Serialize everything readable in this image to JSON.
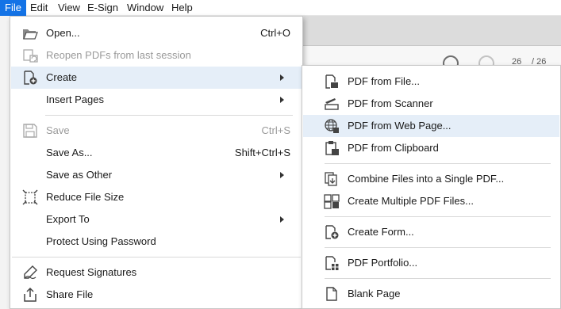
{
  "menubar": {
    "items": [
      "File",
      "Edit",
      "View",
      "E-Sign",
      "Window",
      "Help"
    ],
    "active": "File"
  },
  "background": {
    "page_current": "26",
    "page_total": "/ 26"
  },
  "file_menu": {
    "open": {
      "label": "Open...",
      "shortcut": "Ctrl+O"
    },
    "reopen": {
      "label": "Reopen PDFs from last session"
    },
    "create": {
      "label": "Create"
    },
    "insert_pages": {
      "label": "Insert Pages"
    },
    "save": {
      "label": "Save",
      "shortcut": "Ctrl+S"
    },
    "save_as": {
      "label": "Save As...",
      "shortcut": "Shift+Ctrl+S"
    },
    "save_as_other": {
      "label": "Save as Other"
    },
    "reduce_size": {
      "label": "Reduce File Size"
    },
    "export_to": {
      "label": "Export To"
    },
    "protect": {
      "label": "Protect Using Password"
    },
    "request_signatures": {
      "label": "Request Signatures"
    },
    "share_file": {
      "label": "Share File"
    }
  },
  "create_submenu": {
    "pdf_from_file": "PDF from File...",
    "pdf_from_scanner": "PDF from Scanner",
    "pdf_from_web": "PDF from Web Page...",
    "pdf_from_clipboard": "PDF from Clipboard",
    "combine_files": "Combine Files into a Single PDF...",
    "create_multiple": "Create Multiple PDF Files...",
    "create_form": "Create Form...",
    "pdf_portfolio": "PDF Portfolio...",
    "blank_page": "Blank Page"
  },
  "colors": {
    "accent": "#1473e6",
    "highlight": "#e5eef8",
    "disabled_text": "#9a9a9a"
  }
}
